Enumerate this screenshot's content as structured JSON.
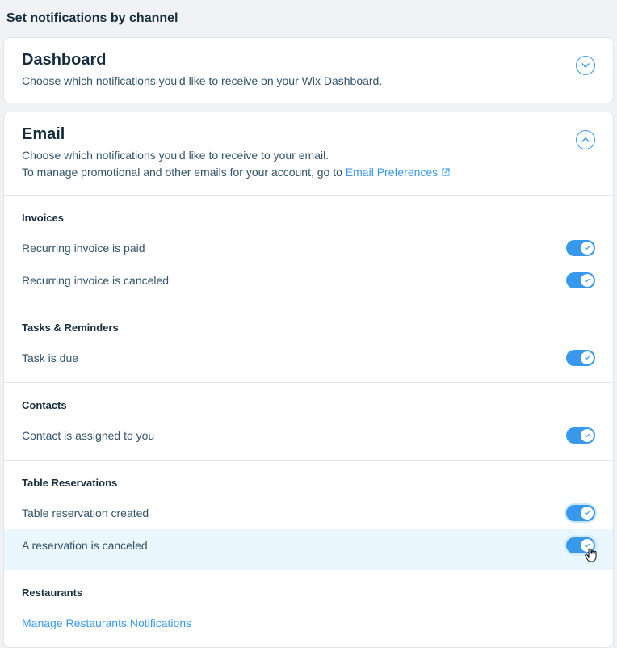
{
  "pageTitle": "Set notifications by channel",
  "dashboard": {
    "title": "Dashboard",
    "desc": "Choose which notifications you'd like to receive on your Wix Dashboard."
  },
  "email": {
    "title": "Email",
    "desc1": "Choose which notifications you'd like to receive to your email.",
    "desc2": "To manage promotional and other emails for your account, go to ",
    "linkText": "Email Preferences"
  },
  "sections": {
    "invoices": {
      "title": "Invoices",
      "items": [
        {
          "label": "Recurring invoice is paid"
        },
        {
          "label": "Recurring invoice is canceled"
        }
      ]
    },
    "tasks": {
      "title": "Tasks & Reminders",
      "items": [
        {
          "label": "Task is due"
        }
      ]
    },
    "contacts": {
      "title": "Contacts",
      "items": [
        {
          "label": "Contact is assigned to you"
        }
      ]
    },
    "tableReservations": {
      "title": "Table Reservations",
      "items": [
        {
          "label": "Table reservation created"
        },
        {
          "label": "A reservation is canceled"
        }
      ]
    },
    "restaurants": {
      "title": "Restaurants",
      "linkText": "Manage Restaurants Notifications"
    }
  }
}
